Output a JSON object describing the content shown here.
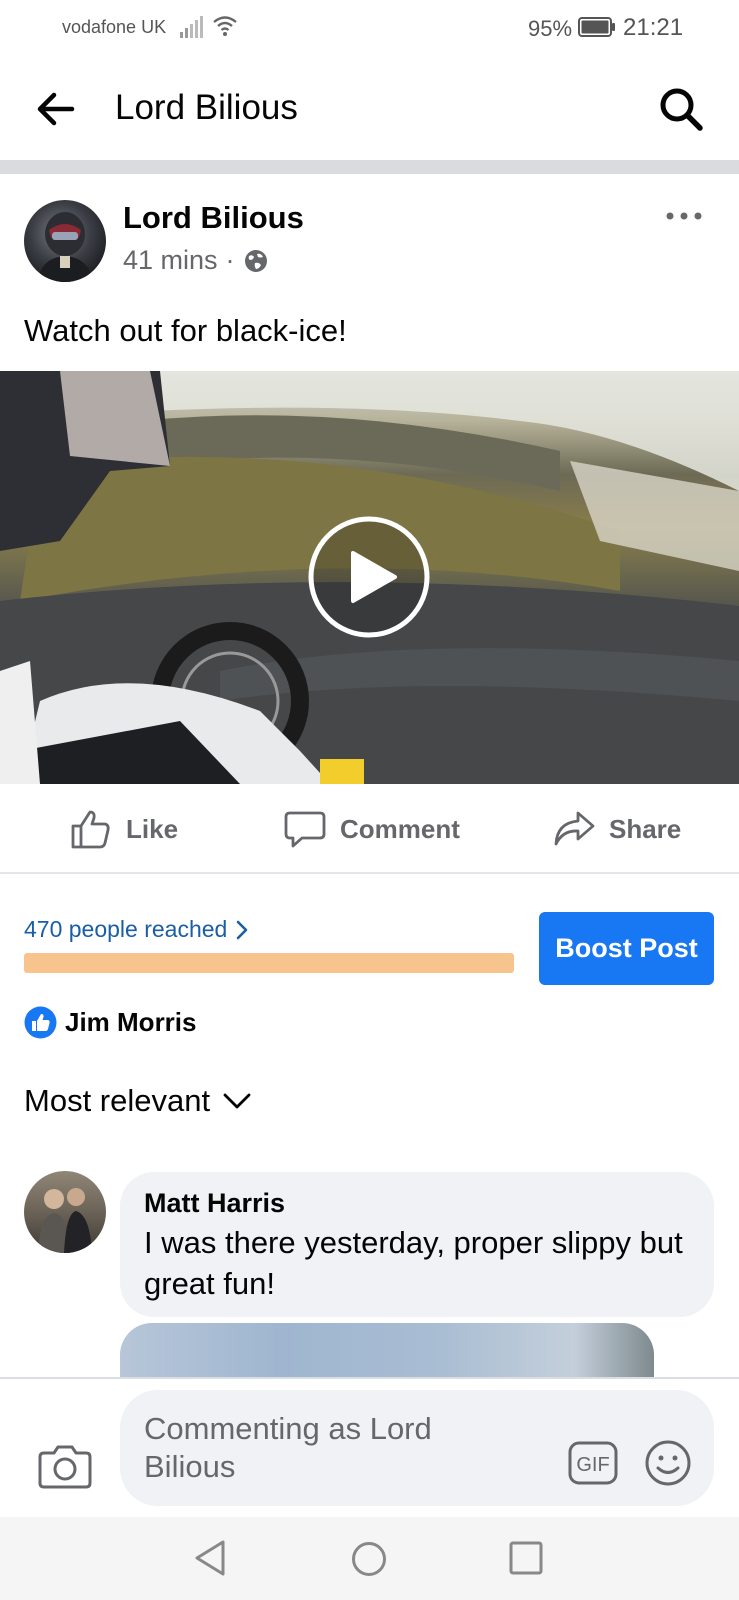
{
  "status_bar": {
    "carrier": "vodafone UK",
    "battery": "95%",
    "time": "21:21"
  },
  "header": {
    "title": "Lord Bilious",
    "back_icon": "arrow-left-icon",
    "search_icon": "search-icon"
  },
  "post": {
    "author": "Lord Bilious",
    "time": "41 mins",
    "separator": "·",
    "privacy_icon": "globe-icon",
    "text": "Watch out for black-ice!",
    "video_icon": "play-icon"
  },
  "actions": {
    "like": "Like",
    "comment": "Comment",
    "share": "Share"
  },
  "insights": {
    "reach": "470 people reached",
    "boost": "Boost Post",
    "bar_color": "#f7c48e"
  },
  "reactions": {
    "name": "Jim Morris"
  },
  "sort": {
    "label": "Most relevant"
  },
  "comments": [
    {
      "author": "Matt Harris",
      "text": "I was there yesterday, proper slippy but great fun!"
    }
  ],
  "composer": {
    "placeholder": "Commenting as Lord Bilious",
    "gif_label": "GIF"
  },
  "colors": {
    "brand": "#1877f2",
    "link": "#1a5ea8",
    "secondary_text": "#65676b"
  }
}
